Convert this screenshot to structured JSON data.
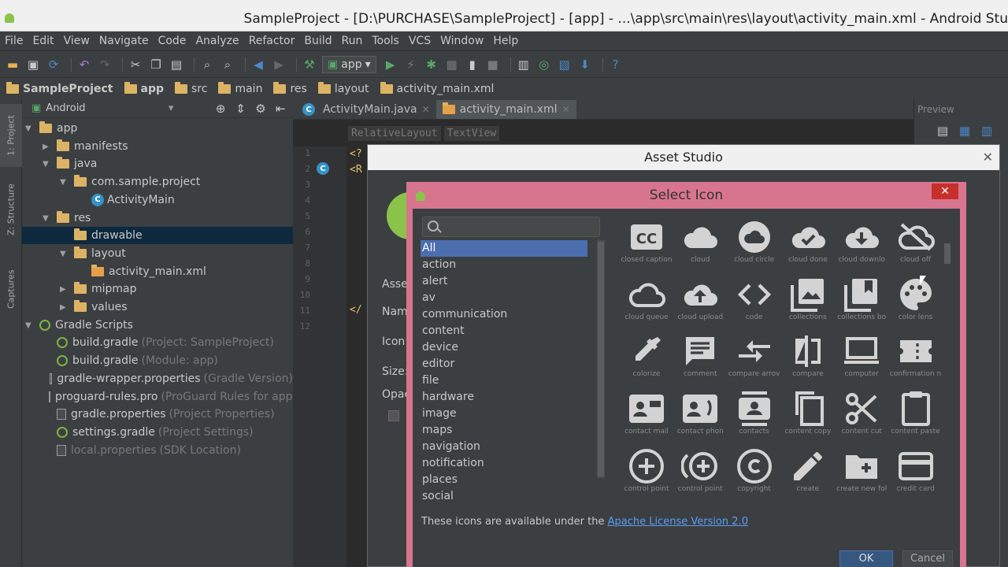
{
  "window": {
    "title": "SampleProject - [D:\\PURCHASE\\SampleProject] - [app] - ...\\app\\src\\main\\res\\layout\\activity_main.xml - Android Stu"
  },
  "menu": [
    "File",
    "Edit",
    "View",
    "Navigate",
    "Code",
    "Analyze",
    "Refactor",
    "Build",
    "Run",
    "Tools",
    "VCS",
    "Window",
    "Help"
  ],
  "toolbar": {
    "run_config": "app"
  },
  "nav": [
    "SampleProject",
    "app",
    "src",
    "main",
    "res",
    "layout",
    "activity_main.xml"
  ],
  "left_strip": {
    "project": "1: Project",
    "structure": "Z: Structure",
    "captures": "Captures"
  },
  "project_panel": {
    "view_mode": "Android",
    "tree": [
      {
        "label": "app",
        "indent": 0,
        "open": true,
        "icon": "folder"
      },
      {
        "label": "manifests",
        "indent": 1,
        "open": false,
        "icon": "folder"
      },
      {
        "label": "java",
        "indent": 1,
        "open": true,
        "icon": "folder"
      },
      {
        "label": "com.sample.project",
        "indent": 2,
        "open": true,
        "icon": "package"
      },
      {
        "label": "ActivityMain",
        "indent": 3,
        "icon": "class"
      },
      {
        "label": "res",
        "indent": 1,
        "open": true,
        "icon": "folder"
      },
      {
        "label": "drawable",
        "indent": 2,
        "icon": "folder",
        "selected": true
      },
      {
        "label": "layout",
        "indent": 2,
        "open": true,
        "icon": "folder"
      },
      {
        "label": "activity_main.xml",
        "indent": 3,
        "icon": "xml"
      },
      {
        "label": "mipmap",
        "indent": 2,
        "open": false,
        "icon": "folder"
      },
      {
        "label": "values",
        "indent": 2,
        "open": false,
        "icon": "folder"
      },
      {
        "label": "Gradle Scripts",
        "indent": 0,
        "open": true,
        "icon": "gradle"
      },
      {
        "label": "build.gradle",
        "indent": 1,
        "hint": "(Project: SampleProject)",
        "icon": "gradle"
      },
      {
        "label": "build.gradle",
        "indent": 1,
        "hint": "(Module: app)",
        "icon": "gradle"
      },
      {
        "label": "gradle-wrapper.properties",
        "indent": 1,
        "hint": "(Gradle Version)",
        "icon": "file"
      },
      {
        "label": "proguard-rules.pro",
        "indent": 1,
        "hint": "(ProGuard Rules for app)",
        "icon": "file"
      },
      {
        "label": "gradle.properties",
        "indent": 1,
        "hint": "(Project Properties)",
        "icon": "file"
      },
      {
        "label": "settings.gradle",
        "indent": 1,
        "hint": "(Project Settings)",
        "icon": "gradle"
      },
      {
        "label": "local.properties",
        "indent": 1,
        "hint": "(SDK Location)",
        "icon": "file",
        "dim": true
      }
    ]
  },
  "editor": {
    "tabs": [
      {
        "label": "ActivityMain.java",
        "active": false
      },
      {
        "label": "activity_main.xml",
        "active": true
      }
    ],
    "breadcrumbs": [
      "RelativeLayout",
      "TextView"
    ],
    "line_numbers": [
      "1",
      "2",
      "3",
      "4",
      "5",
      "6",
      "7",
      "8",
      "9",
      "10",
      "11",
      "12"
    ],
    "code_line_1": "<?",
    "code_line_2": "<R",
    "code_line_11": "</"
  },
  "preview": {
    "label": "Preview"
  },
  "asset_studio": {
    "title": "Asset Studio",
    "labels": [
      "Asse",
      "Nam",
      "Icon:",
      "Size:",
      "Opac"
    ]
  },
  "select_icon": {
    "title": "Select Icon",
    "categories": [
      "All",
      "action",
      "alert",
      "av",
      "communication",
      "content",
      "device",
      "editor",
      "file",
      "hardware",
      "image",
      "maps",
      "navigation",
      "notification",
      "places",
      "social"
    ],
    "selected_category": "All",
    "icons": [
      {
        "name": "closed caption",
        "caption": "closed caption",
        "glyph": "cc"
      },
      {
        "name": "cloud",
        "caption": "cloud",
        "glyph": "cloud"
      },
      {
        "name": "cloud circle",
        "caption": "cloud circle",
        "glyph": "cloud-circle"
      },
      {
        "name": "cloud done",
        "caption": "cloud done",
        "glyph": "cloud-done"
      },
      {
        "name": "cloud download",
        "caption": "cloud downlo",
        "glyph": "cloud-download"
      },
      {
        "name": "cloud off",
        "caption": "cloud off",
        "glyph": "cloud-off"
      },
      {
        "name": "cloud queue",
        "caption": "cloud queue",
        "glyph": "cloud-queue"
      },
      {
        "name": "cloud upload",
        "caption": "cloud upload",
        "glyph": "cloud-upload"
      },
      {
        "name": "code",
        "caption": "code",
        "glyph": "code"
      },
      {
        "name": "collections",
        "caption": "collections",
        "glyph": "collections"
      },
      {
        "name": "collections bookmark",
        "caption": "collections bo",
        "glyph": "collections-bookmark"
      },
      {
        "name": "color lens",
        "caption": "color lens",
        "glyph": "color-lens"
      },
      {
        "name": "colorize",
        "caption": "colorize",
        "glyph": "colorize"
      },
      {
        "name": "comment",
        "caption": "comment",
        "glyph": "comment"
      },
      {
        "name": "compare arrows",
        "caption": "compare arrov",
        "glyph": "compare-arrows"
      },
      {
        "name": "compare",
        "caption": "compare",
        "glyph": "compare"
      },
      {
        "name": "computer",
        "caption": "computer",
        "glyph": "computer"
      },
      {
        "name": "confirmation number",
        "caption": "confirmation n",
        "glyph": "confirmation"
      },
      {
        "name": "contact mail",
        "caption": "contact mail",
        "glyph": "contact-mail"
      },
      {
        "name": "contact phone",
        "caption": "contact phon",
        "glyph": "contact-phone"
      },
      {
        "name": "contacts",
        "caption": "contacts",
        "glyph": "contacts"
      },
      {
        "name": "content copy",
        "caption": "content copy",
        "glyph": "content-copy"
      },
      {
        "name": "content cut",
        "caption": "content cut",
        "glyph": "content-cut"
      },
      {
        "name": "content paste",
        "caption": "content paste",
        "glyph": "content-paste"
      },
      {
        "name": "control point",
        "caption": "control point",
        "glyph": "control-point"
      },
      {
        "name": "control point duplicate",
        "caption": "control point",
        "glyph": "control-point-dup"
      },
      {
        "name": "copyright",
        "caption": "copyright",
        "glyph": "copyright"
      },
      {
        "name": "create",
        "caption": "create",
        "glyph": "create"
      },
      {
        "name": "create new folder",
        "caption": "create new fol",
        "glyph": "create-new-folder"
      },
      {
        "name": "credit card",
        "caption": "credit card",
        "glyph": "credit-card"
      }
    ],
    "license_text": "These icons are available under the ",
    "license_link": "Apache License Version 2.0",
    "ok_label": "OK",
    "cancel_label": "Cancel"
  },
  "colors": {
    "accent_pink": "#d7758e",
    "selection": "#4b6eaf",
    "close_red": "#c7302a",
    "icon_gray": "#d3d3d3"
  }
}
